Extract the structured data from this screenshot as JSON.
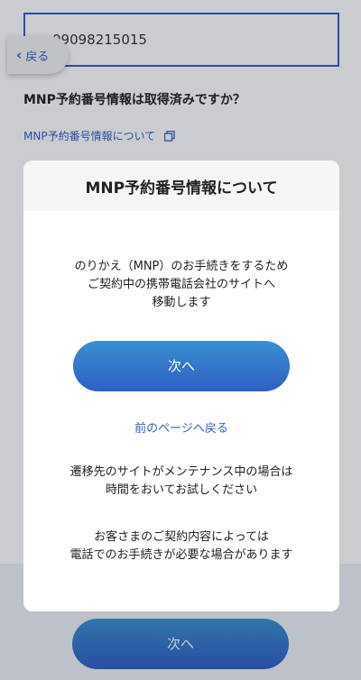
{
  "background": {
    "phone_number_value": "09098215015",
    "back_label": "戻る",
    "question": "MNP予約番号情報は取得済みですか？",
    "info_link": "MNP予約番号情報について",
    "next_button_label": "次へ"
  },
  "modal": {
    "title": "MNP予約番号情報について",
    "message_lines": [
      "のりかえ（MNP）のお手続きをするため",
      "ご契約中の携帯電話会社のサイトへ",
      "移動します"
    ],
    "next_button_label": "次へ",
    "prev_link": "前のページへ戻る",
    "note1_lines": [
      "遷移先のサイトがメンテナンス中の場合は",
      "時間をおいてお試しください"
    ],
    "note2_lines": [
      "お客さまのご契約内容によっては",
      "電話でのお手続きが必要な場合があります"
    ]
  },
  "colors": {
    "accent_blue": "#2f5fc4",
    "button_gradient_top": "#3a8fd0",
    "overlay": "rgba(20,25,40,0.22)"
  },
  "icons": {
    "back": "chevron-left-icon",
    "copy": "copy-icon"
  }
}
